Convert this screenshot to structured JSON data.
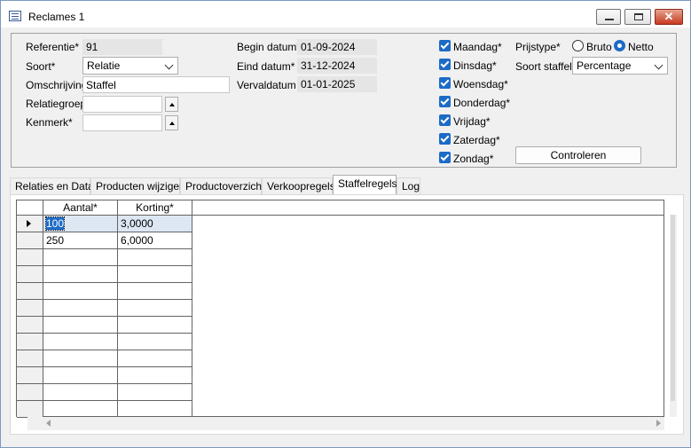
{
  "window": {
    "title": "Reclames 1"
  },
  "form": {
    "referentie": {
      "label": "Referentie*",
      "value": "91"
    },
    "soort": {
      "label": "Soort*",
      "value": "Relatie"
    },
    "omschrijving": {
      "label": "Omschrijving",
      "value": "Staffel"
    },
    "relatiegroep": {
      "label": "Relatiegroep",
      "value": ""
    },
    "kenmerk": {
      "label": "Kenmerk*",
      "value": ""
    },
    "begin_datum": {
      "label": "Begin datum*",
      "value": "01-09-2024"
    },
    "eind_datum": {
      "label": "Eind datum*",
      "value": "31-12-2024"
    },
    "vervaldatum": {
      "label": "Vervaldatum",
      "value": "01-01-2025"
    },
    "days": [
      {
        "label": "Maandag*",
        "checked": true
      },
      {
        "label": "Dinsdag*",
        "checked": true
      },
      {
        "label": "Woensdag*",
        "checked": true
      },
      {
        "label": "Donderdag*",
        "checked": true
      },
      {
        "label": "Vrijdag*",
        "checked": true
      },
      {
        "label": "Zaterdag*",
        "checked": true
      },
      {
        "label": "Zondag*",
        "checked": true
      }
    ],
    "prijstype": {
      "label": "Prijstype*",
      "options": [
        "Bruto",
        "Netto"
      ],
      "selected": "Netto"
    },
    "soort_staffel": {
      "label": "Soort staffel*",
      "value": "Percentage"
    },
    "controleren_label": "Controleren"
  },
  "tabs": [
    {
      "label": "Relaties en Data",
      "active": false
    },
    {
      "label": "Producten wijzigen",
      "active": false
    },
    {
      "label": "Productoverzicht",
      "active": false
    },
    {
      "label": "Verkoopregels",
      "active": false
    },
    {
      "label": "Staffelregels",
      "active": true
    },
    {
      "label": "Log",
      "active": false
    }
  ],
  "grid": {
    "columns": [
      "Aantal*",
      "Korting*"
    ],
    "rows": [
      [
        "100",
        "3,0000"
      ],
      [
        "250",
        "6,0000"
      ]
    ]
  }
}
